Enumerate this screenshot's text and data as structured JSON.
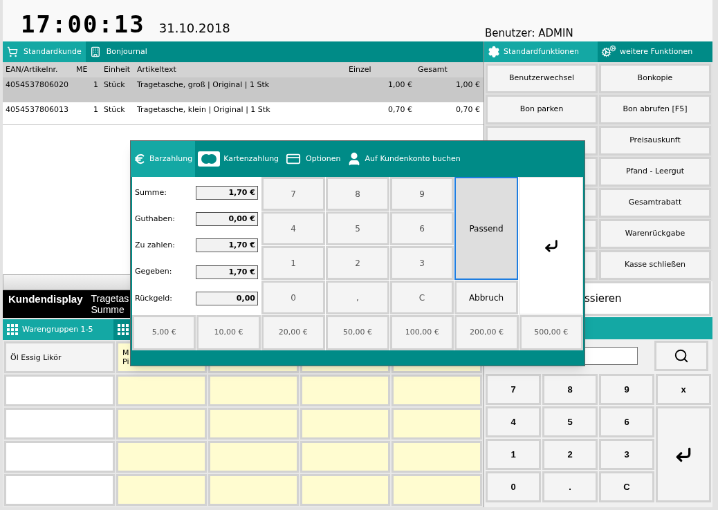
{
  "header": {
    "time": "17:00:13",
    "date": "31.10.2018",
    "user": "Benutzer: ADMIN"
  },
  "customer_tabs": [
    {
      "label": "Standardkunde",
      "selected": true
    },
    {
      "label": "Bonjournal",
      "selected": false
    }
  ],
  "receipt_table": {
    "columns": [
      "EAN/Artikelnr.",
      "ME",
      "Einheit",
      "Artikeltext",
      "Einzel",
      "Gesamt"
    ],
    "rows": [
      {
        "selected": true,
        "cells": [
          "4054537806020",
          "1",
          "Stück",
          "Tragetasche, groß | Original | 1 Stk",
          "1,00 €",
          "1,00 €"
        ]
      },
      {
        "selected": false,
        "cells": [
          "4054537806013",
          "1",
          "Stück",
          "Tragetasche, klein | Original | 1 Stk",
          "0,70 €",
          "0,70 €"
        ]
      }
    ]
  },
  "customer_display": {
    "title": "Kundendisplay",
    "lines": [
      "Tragetas",
      "Summe"
    ]
  },
  "group_tabs": [
    {
      "label": "Warengruppen 1-5",
      "selected": true
    },
    {
      "selected": false
    }
  ],
  "group_grid": [
    [
      {
        "kind": "group",
        "lines": [
          "Öl Essig Likör"
        ]
      },
      {
        "kind": "product",
        "lines": [
          "M",
          "Pi"
        ]
      },
      {
        "kind": "product"
      },
      {
        "kind": "product"
      },
      {
        "kind": "product"
      }
    ],
    [
      {
        "kind": "group"
      },
      {
        "kind": "product"
      },
      {
        "kind": "product"
      },
      {
        "kind": "product"
      },
      {
        "kind": "product"
      }
    ],
    [
      {
        "kind": "group"
      },
      {
        "kind": "product"
      },
      {
        "kind": "product"
      },
      {
        "kind": "product"
      },
      {
        "kind": "product"
      }
    ],
    [
      {
        "kind": "group"
      },
      {
        "kind": "product"
      },
      {
        "kind": "product"
      },
      {
        "kind": "product"
      },
      {
        "kind": "product"
      }
    ],
    [
      {
        "kind": "group"
      },
      {
        "kind": "product"
      },
      {
        "kind": "product"
      },
      {
        "kind": "product"
      },
      {
        "kind": "product"
      }
    ]
  ],
  "function_tabs": [
    {
      "label": "Standardfunktionen",
      "selected": true
    },
    {
      "label": "weitere Funktionen",
      "selected": false
    }
  ],
  "functions": [
    {
      "left": "Benutzerwechsel",
      "right": "Bonkopie"
    },
    {
      "left": "Bon parken",
      "right": "Bon abrufen [F5]"
    },
    {
      "right": "Preisauskunft"
    },
    {
      "right": "Pfand - Leergut"
    },
    {
      "right": "Gesamtrabatt"
    },
    {
      "right": "Warenrückgabe"
    },
    {
      "right": "Kasse schließen"
    }
  ],
  "checkout_button": "ssieren",
  "keypad": [
    "7",
    "8",
    "9",
    "x",
    "4",
    "5",
    "6",
    "1",
    "2",
    "3",
    "0",
    ".",
    "C"
  ],
  "payment_dialog": {
    "tabs": [
      {
        "label": "Barzahlung",
        "selected": true
      },
      {
        "label": "Kartenzahlung",
        "selected": false
      },
      {
        "label": "Optionen",
        "selected": false
      },
      {
        "label": "Auf Kundenkonto buchen",
        "selected": false
      }
    ],
    "fields": [
      {
        "label": "Summe:",
        "value": "1,70 €"
      },
      {
        "label": "Guthaben:",
        "value": "0,00 €"
      },
      {
        "label": "Zu zahlen:",
        "value": "1,70 €"
      },
      {
        "label": "Gegeben:",
        "value": "1,70 €"
      },
      {
        "label": "Rückgeld:",
        "value": "0,00"
      }
    ],
    "keypad": [
      "7",
      "8",
      "9",
      "4",
      "5",
      "6",
      "1",
      "2",
      "3",
      "0",
      ",",
      "C"
    ],
    "exact_button": {
      "label": "Passend",
      "focused": true
    },
    "cancel_button": "Abbruch",
    "amounts": [
      "5,00 €",
      "10,00 €",
      "20,00 €",
      "50,00 €",
      "100,00 €",
      "200,00 €",
      "500,00 €"
    ]
  }
}
